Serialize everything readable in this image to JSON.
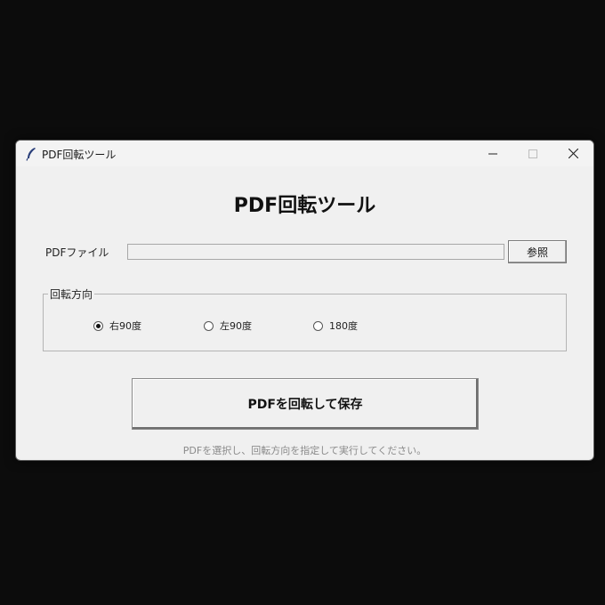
{
  "window": {
    "title": "PDF回転ツール",
    "controls": {
      "minimize_icon": "minimize-icon",
      "maximize_icon": "maximize-icon",
      "close_icon": "close-icon"
    }
  },
  "main": {
    "heading": "PDF回転ツール",
    "file": {
      "label": "PDFファイル",
      "value": "",
      "placeholder": "",
      "browse_label": "参照"
    },
    "rotation": {
      "legend": "回転方向",
      "options": [
        {
          "label": "右90度",
          "checked": true
        },
        {
          "label": "左90度",
          "checked": false
        },
        {
          "label": "180度",
          "checked": false
        }
      ]
    },
    "action_button": "PDFを回転して保存",
    "status": "PDFを選択し、回転方向を指定して実行してください。"
  },
  "colors": {
    "desktop": "#0c0c0c",
    "window_bg": "#f0f0f0",
    "status_text": "#8a8a8a"
  }
}
